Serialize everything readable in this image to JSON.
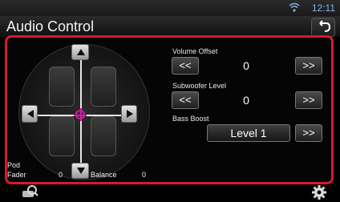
{
  "status": {
    "time": "12:11",
    "wifi_icon": "wifi-icon"
  },
  "header": {
    "title": "Audio Control",
    "back_icon": "back-icon"
  },
  "position": {
    "pod_label": "Pod",
    "fader_label": "Fader",
    "fader_value": "0",
    "balance_label": "Balance",
    "balance_value": "0"
  },
  "controls": {
    "volume_offset": {
      "label": "Volume Offset",
      "value": "0",
      "dec_label": "<<",
      "inc_label": ">>"
    },
    "subwoofer_level": {
      "label": "Subwoofer Level",
      "value": "0",
      "dec_label": "<<",
      "inc_label": ">>"
    },
    "bass_boost": {
      "label": "Bass Boost",
      "value": "Level 1",
      "inc_label": ">>"
    }
  },
  "colors": {
    "accent_border": "#d21c2c",
    "time_color": "#7fb4e6",
    "target_color": "#d61aa8"
  },
  "bottom": {
    "left_icon": "search-car-icon",
    "right_icon": "gear-icon"
  }
}
